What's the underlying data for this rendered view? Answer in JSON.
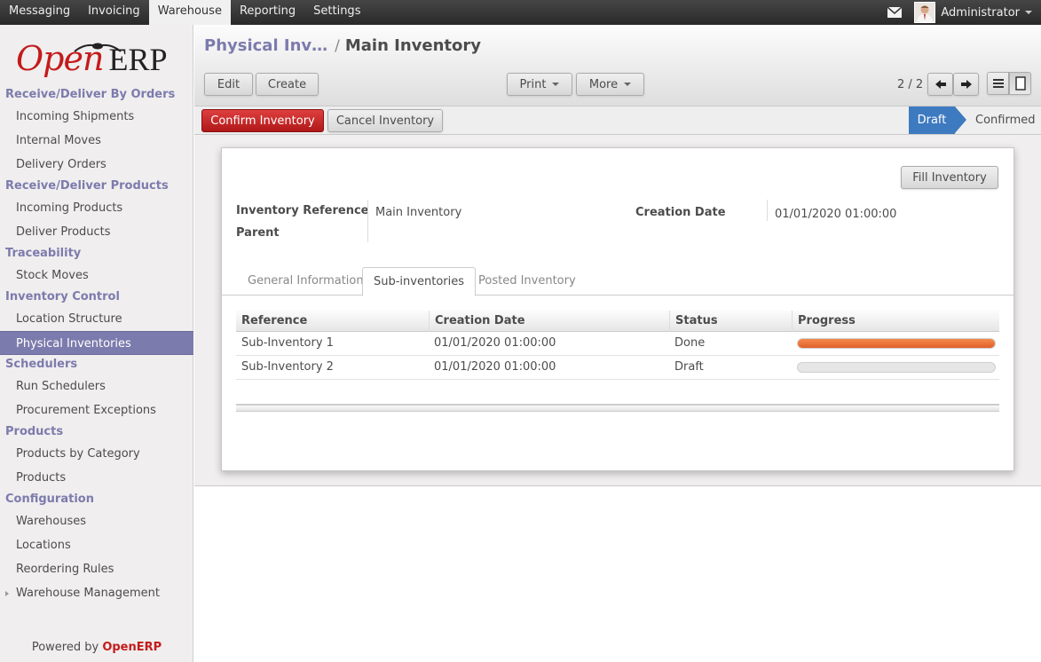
{
  "topbar": {
    "menu": [
      "Messaging",
      "Invoicing",
      "Warehouse",
      "Reporting",
      "Settings"
    ],
    "active_menu": "Warehouse",
    "user": "Administrator"
  },
  "logo": {
    "open": "Open",
    "erp": "ERP"
  },
  "sidebar": [
    {
      "section": "Receive/Deliver By Orders",
      "items": [
        "Incoming Shipments",
        "Internal Moves",
        "Delivery Orders"
      ]
    },
    {
      "section": "Receive/Deliver Products",
      "items": [
        "Incoming Products",
        "Deliver Products"
      ]
    },
    {
      "section": "Traceability",
      "items": [
        "Stock Moves"
      ]
    },
    {
      "section": "Inventory Control",
      "items": [
        "Location Structure",
        "Physical Inventories"
      ]
    },
    {
      "section": "Schedulers",
      "items": [
        "Run Schedulers",
        "Procurement Exceptions"
      ]
    },
    {
      "section": "Products",
      "items": [
        "Products by Category",
        "Products"
      ]
    },
    {
      "section": "Configuration",
      "items": [
        "Warehouses",
        "Locations",
        "Reordering Rules",
        "Warehouse Management"
      ]
    }
  ],
  "sidebar_active": "Physical Inventories",
  "powered": {
    "prefix": "Powered by",
    "brand": "OpenERP"
  },
  "breadcrumb": {
    "parent": "Physical Inv…",
    "separator": "/",
    "current": "Main Inventory"
  },
  "toolbar": {
    "edit": "Edit",
    "create": "Create",
    "print": "Print",
    "more": "More",
    "pager": "2 / 2"
  },
  "status": {
    "confirm": "Confirm Inventory",
    "cancel": "Cancel Inventory",
    "stages": [
      "Draft",
      "Confirmed"
    ],
    "current_stage": "Draft"
  },
  "form": {
    "fill_button": "Fill Inventory",
    "ref_label": "Inventory Reference",
    "ref_value": "Main Inventory",
    "parent_label": "Parent",
    "date_label": "Creation Date",
    "date_value": "01/01/2020 01:00:00"
  },
  "tabs": [
    "General Information",
    "Sub-inventories",
    "Posted Inventory"
  ],
  "active_tab": "Sub-inventories",
  "table": {
    "columns": [
      "Reference",
      "Creation Date",
      "Status",
      "Progress"
    ],
    "rows": [
      {
        "reference": "Sub-Inventory 1",
        "date": "01/01/2020 01:00:00",
        "status": "Done",
        "progress": 100
      },
      {
        "reference": "Sub-Inventory 2",
        "date": "01/01/2020 01:00:00",
        "status": "Draft",
        "progress": 0
      }
    ]
  },
  "colors": {
    "accent": "#7c7bad",
    "brand_red": "#c41b1b",
    "progress": "#e8683a",
    "stage_active": "#3e7ac0"
  }
}
